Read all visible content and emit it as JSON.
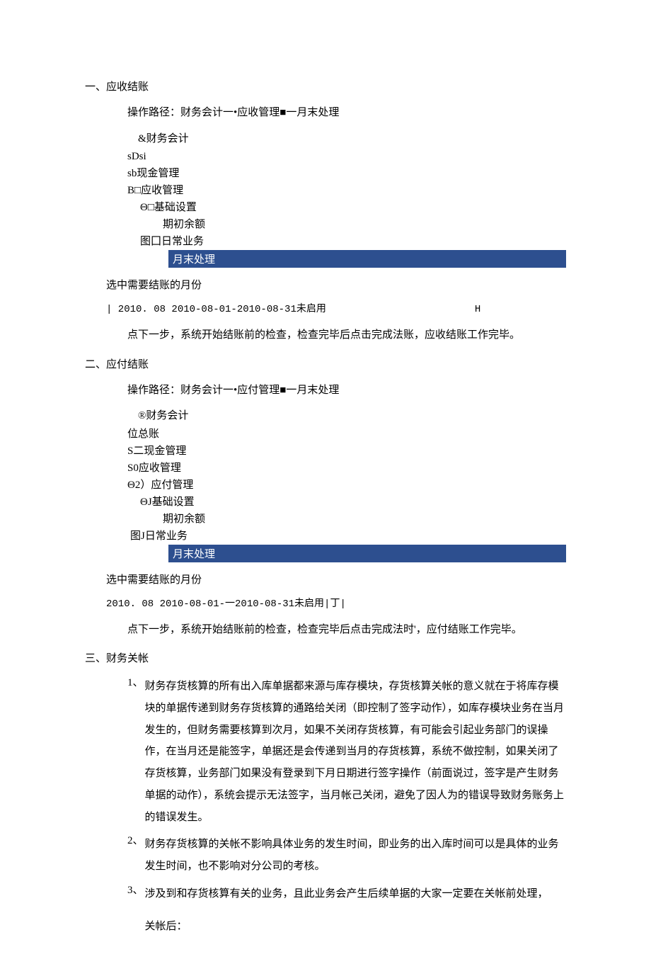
{
  "section1": {
    "title": "一、应收结账",
    "op_path": "操作路径：财务会计一•应收管理■一月末处理",
    "tree": {
      "head": "&财务会计",
      "r1": "sDsi",
      "r2": "sb现金管理",
      "r3": "B□应收管理",
      "r4": "Θ□基础设置",
      "r5": "期初余额",
      "r6": "图囗日常业务",
      "highlight": "月末处理"
    },
    "select_month": "选中需要结账的月份",
    "code": "| 2010. 08     2010-08-01-2010-08-31未启用",
    "code_tail": "H",
    "next_step": "点下一步，系统开始结账前的检查，检查完毕后点击完成法账，应收结账工作完毕。"
  },
  "section2": {
    "title": "二、应付结账",
    "op_path": "操作路径：财务会计一•应付管理■一月末处理",
    "tree": {
      "head": "®财务会计",
      "r1": "位总账",
      "r2": "S二现金管理",
      "r3": "S0应收管理",
      "r4": "Θ2）应付管理",
      "r5": "ΘJ基础设置",
      "r6": "期初余额",
      "r7": "图J日常业务",
      "highlight": "月末处理"
    },
    "select_month": "选中需要结账的月份",
    "code": "2010. 08       2010-08-01-一2010-08-31未启用|丁|",
    "next_step": "点下一步，系统开始结账前的检查，检查完毕后点击完成法时'，应付结账工作完毕。"
  },
  "section3": {
    "title": "三、财务关帐",
    "item1_num": "1、",
    "item1": "财务存货核算的所有出入库单据都来源与库存模块，存货核算关帐的意义就在于将库存模块的单据传递到财务存货核算的通路给关闭（即控制了签字动作），如库存模块业务在当月发生的，但财务需要核算到次月，如果不关闭存货核算，有可能会引起业务部门的误操作，在当月还是能签字，单据还是会传递到当月的存货核算，系统不做控制，如果关闭了存货核算，业务部门如果没有登录到下月日期进行签字操作（前面说过，签字是产生财务单据的动作），系统会提示无法签字，当月帐己关闭，避免了因人为的错误导致财务账务上的错误发生。",
    "item2_num": "2、",
    "item2": "财务存货核算的关帐不影响具体业务的发生时间，即业务的出入库时间可以是具体的业务发生时间，也不影响对分公司的考核。",
    "item3_num": "3、",
    "item3": "涉及到和存货核算有关的业务，且此业务会产生后续单据的大家一定要在关帐前处理，",
    "item3_tail": "关帐后："
  }
}
